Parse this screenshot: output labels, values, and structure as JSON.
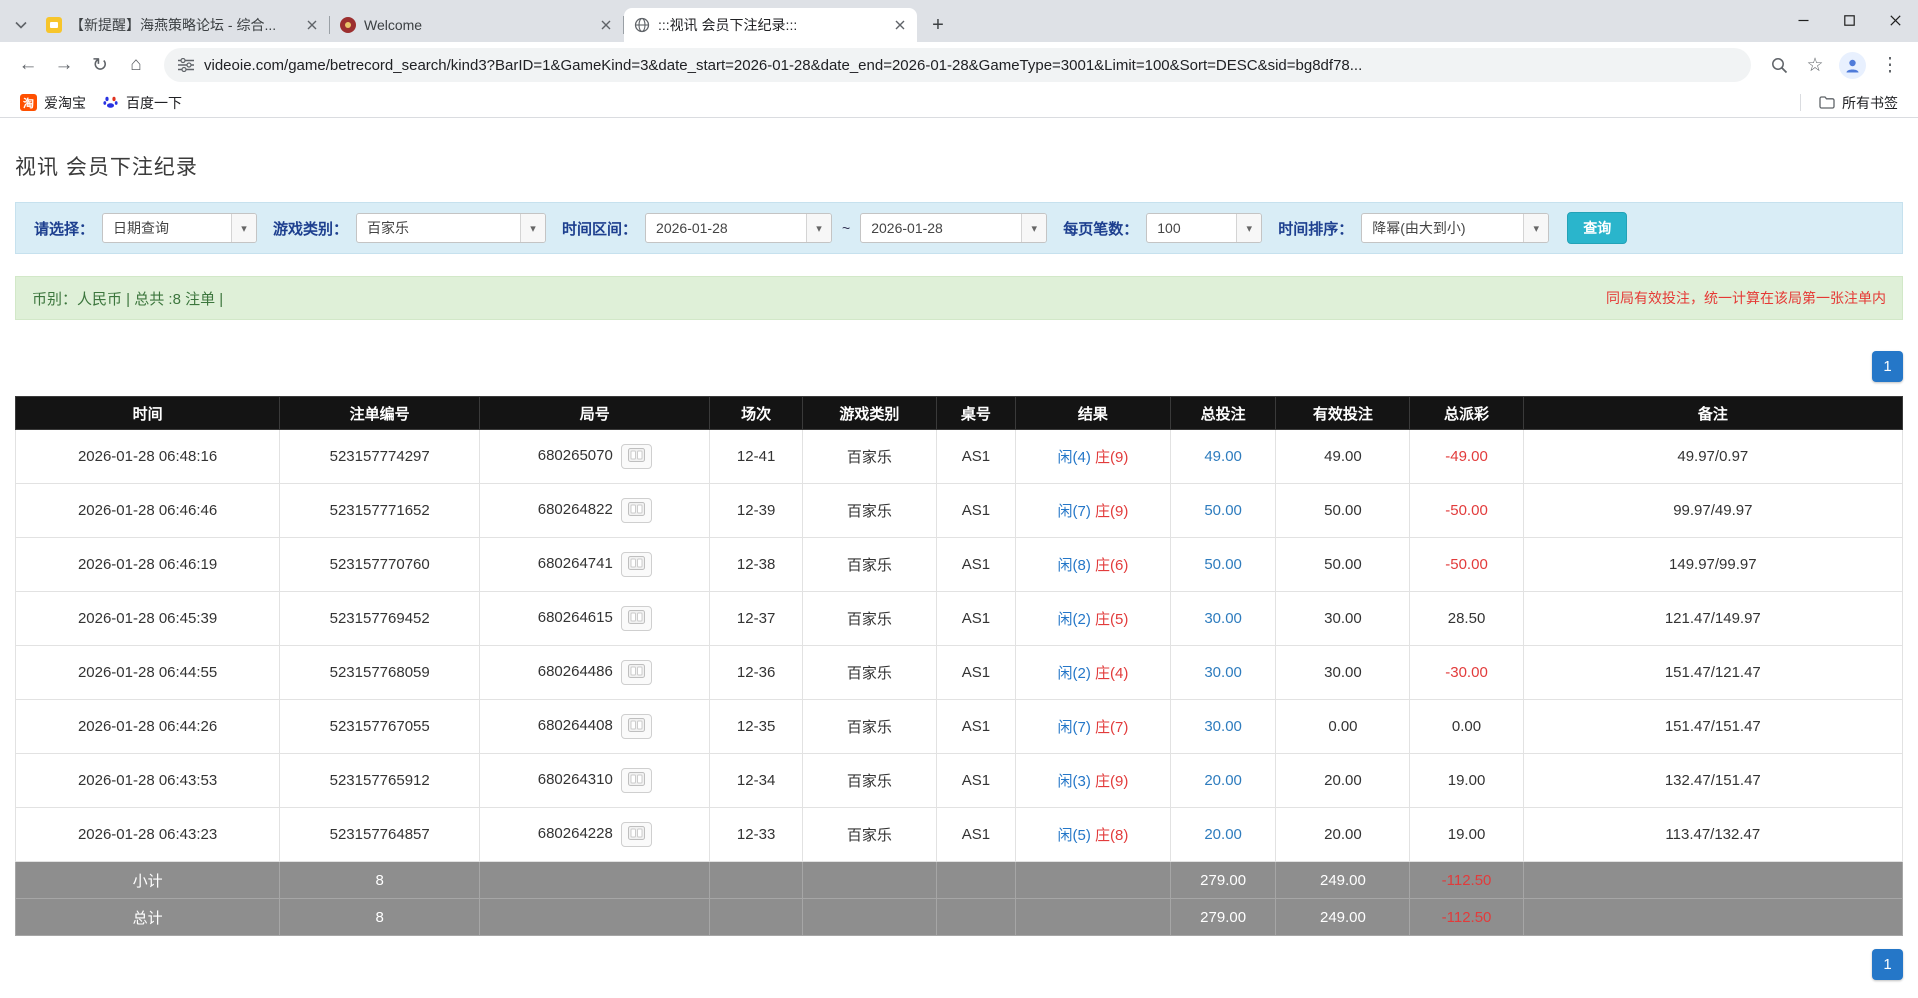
{
  "browser": {
    "tabs": [
      {
        "title": "【新提醒】海燕策略论坛 - 综合...",
        "active": false
      },
      {
        "title": "Welcome",
        "active": false
      },
      {
        "title": ":::视讯 会员下注纪录:::",
        "active": true
      }
    ],
    "url": "videoie.com/game/betrecord_search/kind3?BarID=1&GameKind=3&date_start=2026-01-28&date_end=2026-01-28&GameType=3001&Limit=100&Sort=DESC&sid=bg8df78...",
    "bookmarks": [
      {
        "label": "爱淘宝"
      },
      {
        "label": "百度一下"
      }
    ],
    "all_bookmarks_label": "所有书签",
    "icons": {
      "back": "←",
      "forward": "→",
      "reload": "↻",
      "home": "⌂",
      "bookmark_star": "☆",
      "menu": "⋮",
      "new_tab": "+",
      "dropdown": "▾",
      "taobao_glyph": "淘"
    }
  },
  "page": {
    "title": "视讯 会员下注纪录",
    "filter": {
      "select_label": "请选择：",
      "select_value": "日期查询",
      "game_label": "游戏类别：",
      "game_value": "百家乐",
      "range_label": "时间区间：",
      "date_start": "2026-01-28",
      "range_separator": "~",
      "date_end": "2026-01-28",
      "per_page_label": "每页笔数：",
      "per_page_value": "100",
      "sort_label": "时间排序：",
      "sort_value": "降幂(由大到小)",
      "search_button": "查询"
    },
    "info_bar": {
      "summary": "币别：人民币 | 总共 :8 注单 |",
      "notice": "同局有效投注，统一计算在该局第一张注单内"
    },
    "pagination": {
      "page": "1"
    },
    "table": {
      "headers": [
        "时间",
        "注单编号",
        "局号",
        "场次",
        "游戏类别",
        "桌号",
        "结果",
        "总投注",
        "有效投注",
        "总派彩",
        "备注"
      ],
      "rows": [
        {
          "time": "2026-01-28 06:48:16",
          "bet_no": "523157774297",
          "round_no": "680265070",
          "session": "12-41",
          "game": "百家乐",
          "table_no": "AS1",
          "result_player": "闲(4)",
          "result_banker": "庄(9)",
          "total_bet": "49.00",
          "valid_bet": "49.00",
          "payout": "-49.00",
          "note": "49.97/0.97"
        },
        {
          "time": "2026-01-28 06:46:46",
          "bet_no": "523157771652",
          "round_no": "680264822",
          "session": "12-39",
          "game": "百家乐",
          "table_no": "AS1",
          "result_player": "闲(7)",
          "result_banker": "庄(9)",
          "total_bet": "50.00",
          "valid_bet": "50.00",
          "payout": "-50.00",
          "note": "99.97/49.97"
        },
        {
          "time": "2026-01-28 06:46:19",
          "bet_no": "523157770760",
          "round_no": "680264741",
          "session": "12-38",
          "game": "百家乐",
          "table_no": "AS1",
          "result_player": "闲(8)",
          "result_banker": "庄(6)",
          "total_bet": "50.00",
          "valid_bet": "50.00",
          "payout": "-50.00",
          "note": "149.97/99.97"
        },
        {
          "time": "2026-01-28 06:45:39",
          "bet_no": "523157769452",
          "round_no": "680264615",
          "session": "12-37",
          "game": "百家乐",
          "table_no": "AS1",
          "result_player": "闲(2)",
          "result_banker": "庄(5)",
          "total_bet": "30.00",
          "valid_bet": "30.00",
          "payout": "28.50",
          "note": "121.47/149.97"
        },
        {
          "time": "2026-01-28 06:44:55",
          "bet_no": "523157768059",
          "round_no": "680264486",
          "session": "12-36",
          "game": "百家乐",
          "table_no": "AS1",
          "result_player": "闲(2)",
          "result_banker": "庄(4)",
          "total_bet": "30.00",
          "valid_bet": "30.00",
          "payout": "-30.00",
          "note": "151.47/121.47"
        },
        {
          "time": "2026-01-28 06:44:26",
          "bet_no": "523157767055",
          "round_no": "680264408",
          "session": "12-35",
          "game": "百家乐",
          "table_no": "AS1",
          "result_player": "闲(7)",
          "result_banker": "庄(7)",
          "total_bet": "30.00",
          "valid_bet": "0.00",
          "payout": "0.00",
          "note": "151.47/151.47"
        },
        {
          "time": "2026-01-28 06:43:53",
          "bet_no": "523157765912",
          "round_no": "680264310",
          "session": "12-34",
          "game": "百家乐",
          "table_no": "AS1",
          "result_player": "闲(3)",
          "result_banker": "庄(9)",
          "total_bet": "20.00",
          "valid_bet": "20.00",
          "payout": "19.00",
          "note": "132.47/151.47"
        },
        {
          "time": "2026-01-28 06:43:23",
          "bet_no": "523157764857",
          "round_no": "680264228",
          "session": "12-33",
          "game": "百家乐",
          "table_no": "AS1",
          "result_player": "闲(5)",
          "result_banker": "庄(8)",
          "total_bet": "20.00",
          "valid_bet": "20.00",
          "payout": "19.00",
          "note": "113.47/132.47"
        }
      ],
      "subtotal": {
        "label": "小计",
        "count": "8",
        "total_bet": "279.00",
        "valid_bet": "249.00",
        "payout": "-112.50"
      },
      "total": {
        "label": "总计",
        "count": "8",
        "total_bet": "279.00",
        "valid_bet": "249.00",
        "payout": "-112.50"
      }
    },
    "colors": {
      "header_bg": "#141414",
      "footer_row_bg": "#8e8e8e",
      "accent_cyan": "#2ab5cc",
      "pagination_blue": "#2577c8",
      "player_blue": "#2577c8",
      "banker_red": "#e23b3b",
      "bet_link_blue": "#2e7cbe",
      "filter_bar_bg": "#d9edf6",
      "info_bar_bg": "#dff0d8"
    }
  }
}
